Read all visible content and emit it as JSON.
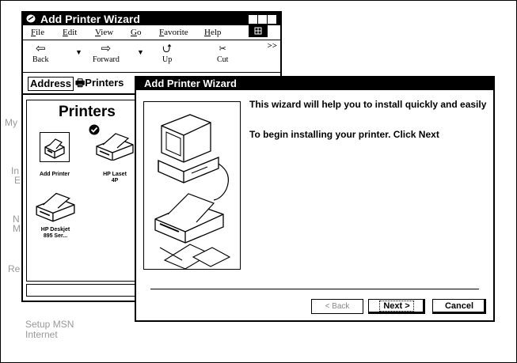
{
  "desktop": {
    "labels": [
      "My",
      "In",
      "E",
      "N",
      "M",
      "Re"
    ],
    "setup_line1": "Setup MSN",
    "setup_line2": "Internet"
  },
  "explorer": {
    "title": "Add Printer Wizard",
    "menu": [
      "File",
      "Edit",
      "View",
      "Go",
      "Favorite",
      "Help"
    ],
    "toolbar": {
      "back": "Back",
      "forward": "Forward",
      "up": "Up",
      "cut": "Cut",
      "more": ">>"
    },
    "address_label": "Address",
    "address_value": "Printers",
    "folder_title": "Printers",
    "items": [
      {
        "label_line1": "Add Printer",
        "label_line2": "",
        "icon": "add-printer-icon"
      },
      {
        "label_line1": "HP Laset",
        "label_line2": "4P",
        "icon": "printer-icon"
      },
      {
        "label_line1": "HP Deskjet",
        "label_line2": "895 Ser...",
        "icon": "printer-icon"
      }
    ]
  },
  "wizard": {
    "title": "Add Printer Wizard",
    "text1": "This wizard will help you to install quickly and easily",
    "text2": "To begin installing your printer. Click Next",
    "back_label": "< Back",
    "next_label": "Next >",
    "cancel_label": "Cancel"
  }
}
